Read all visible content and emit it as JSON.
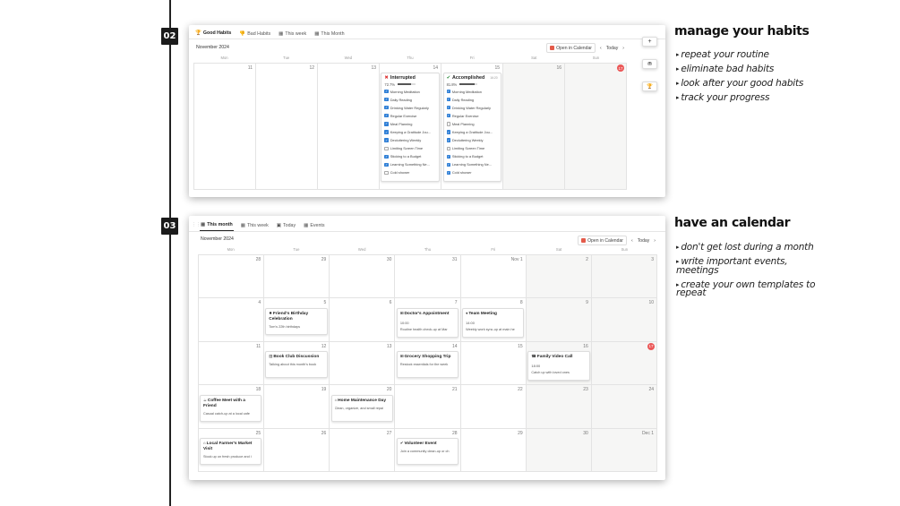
{
  "section_labels": [
    "02",
    "03"
  ],
  "habits_panel": {
    "tabs": [
      {
        "icon": "🏆",
        "label": "Good Habits",
        "active": true
      },
      {
        "icon": "👎",
        "label": "Bad Habits",
        "active": false
      },
      {
        "icon": "▦",
        "label": "This week",
        "active": false
      },
      {
        "icon": "▦",
        "label": "This Month",
        "active": false
      }
    ],
    "month_label": "November 2024",
    "open_calendar": "Open in Calendar",
    "today": "Today",
    "weekdays": [
      "Mon",
      "Tue",
      "Wed",
      "Thu",
      "Fri",
      "Sat",
      "Sun"
    ],
    "days": [
      "11",
      "12",
      "13",
      "14",
      "15",
      "16",
      "17"
    ],
    "today_day": "17",
    "cards": [
      {
        "title": "Interrupted",
        "status_icon": "✖",
        "percent": "72.7%",
        "progress": 0.727,
        "badge": "",
        "items": [
          {
            "label": "Morning Meditation",
            "checked": true
          },
          {
            "label": "Daily Reading",
            "checked": true
          },
          {
            "label": "Drinking Water Regularly",
            "checked": true
          },
          {
            "label": "Regular Exercise",
            "checked": true
          },
          {
            "label": "Meal Planning",
            "checked": true
          },
          {
            "label": "Keeping a Gratitude Jou...",
            "checked": true
          },
          {
            "label": "Decluttering Weekly",
            "checked": true
          },
          {
            "label": "Limiting Screen Time",
            "checked": false
          },
          {
            "label": "Sticking to a Budget",
            "checked": true
          },
          {
            "label": "Learning Something Ne...",
            "checked": true
          },
          {
            "label": "Cold shower",
            "checked": false
          }
        ]
      },
      {
        "title": "Accomplished",
        "status_icon": "✔",
        "percent": "81.8%",
        "progress": 0.818,
        "badge": "16:20",
        "items": [
          {
            "label": "Morning Meditation",
            "checked": true
          },
          {
            "label": "Daily Reading",
            "checked": true
          },
          {
            "label": "Drinking Water Regularly",
            "checked": true
          },
          {
            "label": "Regular Exercise",
            "checked": true
          },
          {
            "label": "Meal Planning",
            "checked": false
          },
          {
            "label": "Keeping a Gratitude Jou...",
            "checked": true
          },
          {
            "label": "Decluttering Weekly",
            "checked": true
          },
          {
            "label": "Limiting Screen Time",
            "checked": false
          },
          {
            "label": "Sticking to a Budget",
            "checked": true
          },
          {
            "label": "Learning Something Ne...",
            "checked": true
          },
          {
            "label": "Cold shower",
            "checked": true
          }
        ]
      }
    ],
    "side_buttons": [
      {
        "icon": "+",
        "name": "plus-icon"
      },
      {
        "icon": "⛃",
        "name": "chat-icon"
      },
      {
        "icon": "🏆",
        "name": "trophy-icon"
      }
    ]
  },
  "calendar_panel": {
    "tabs": [
      {
        "icon": "▦",
        "label": "This month",
        "active": true
      },
      {
        "icon": "▦",
        "label": "This week",
        "active": false
      },
      {
        "icon": "▣",
        "label": "Today",
        "active": false
      },
      {
        "icon": "▦",
        "label": "Events",
        "active": false
      }
    ],
    "month_label": "November 2024",
    "open_calendar": "Open in Calendar",
    "today": "Today",
    "weekdays": [
      "Mon",
      "Tue",
      "Wed",
      "Thu",
      "Fri",
      "Sat",
      "Sun"
    ],
    "weeks": [
      [
        "28",
        "29",
        "30",
        "31",
        "Nov 1",
        "2",
        "3"
      ],
      [
        "4",
        "5",
        "6",
        "7",
        "8",
        "9",
        "10"
      ],
      [
        "11",
        "12",
        "13",
        "14",
        "15",
        "16",
        "17"
      ],
      [
        "18",
        "19",
        "20",
        "21",
        "22",
        "23",
        "24"
      ],
      [
        "25",
        "26",
        "27",
        "28",
        "29",
        "30",
        "Dec 1"
      ]
    ],
    "today_day": "17",
    "events": [
      {
        "week": 1,
        "day": 1,
        "icon": "✸",
        "title": "Friend's Birthday Celebration",
        "time": "",
        "desc": "Tom's 22th birthdays"
      },
      {
        "week": 1,
        "day": 3,
        "icon": "⊞",
        "title": "Doctor's Appointment",
        "time": "10:00",
        "desc": "Routine health check-up at Mar"
      },
      {
        "week": 1,
        "day": 4,
        "icon": "♦",
        "title": "Team Meeting",
        "time": "14:00",
        "desc": "Weekly work sync-up at main he"
      },
      {
        "week": 2,
        "day": 1,
        "icon": "▤",
        "title": "Book Club Discussion",
        "time": "",
        "desc": "Talking about this month's book"
      },
      {
        "week": 2,
        "day": 3,
        "icon": "⊞",
        "title": "Grocery Shopping Trip",
        "time": "",
        "desc": "Restock essentials for the week"
      },
      {
        "week": 2,
        "day": 5,
        "icon": "☎",
        "title": "Family Video Call",
        "time": "18:00",
        "desc": "Catch up with loved ones"
      },
      {
        "week": 3,
        "day": 0,
        "icon": "☕",
        "title": "Coffee Meet with a Friend",
        "time": "",
        "desc": "Casual catch-up at a local cafe"
      },
      {
        "week": 3,
        "day": 2,
        "icon": "⌂",
        "title": "Home Maintenance Day",
        "time": "",
        "desc": "Clean, organize, and small repai"
      },
      {
        "week": 4,
        "day": 0,
        "icon": "⌂",
        "title": "Local Farmer's Market Visit",
        "time": "",
        "desc": "Stock up on fresh produce and i"
      },
      {
        "week": 4,
        "day": 3,
        "icon": "✔",
        "title": "Volunteer Event",
        "time": "",
        "desc": "Join a community clean-up or ch"
      }
    ]
  },
  "section1": {
    "heading": "manage your habits",
    "bullets": [
      "repeat your routine",
      "eliminate bad habits",
      "look after your good habits",
      "track your progress"
    ]
  },
  "section2": {
    "heading": "have an calendar",
    "bullets": [
      "don't get lost during a month",
      "write important events, meetings",
      "create your own templates to repeat"
    ]
  },
  "colors": {
    "accent_blue": "#2f7fd6",
    "today_red": "#eb5757",
    "weekend": "#f6f6f5"
  }
}
